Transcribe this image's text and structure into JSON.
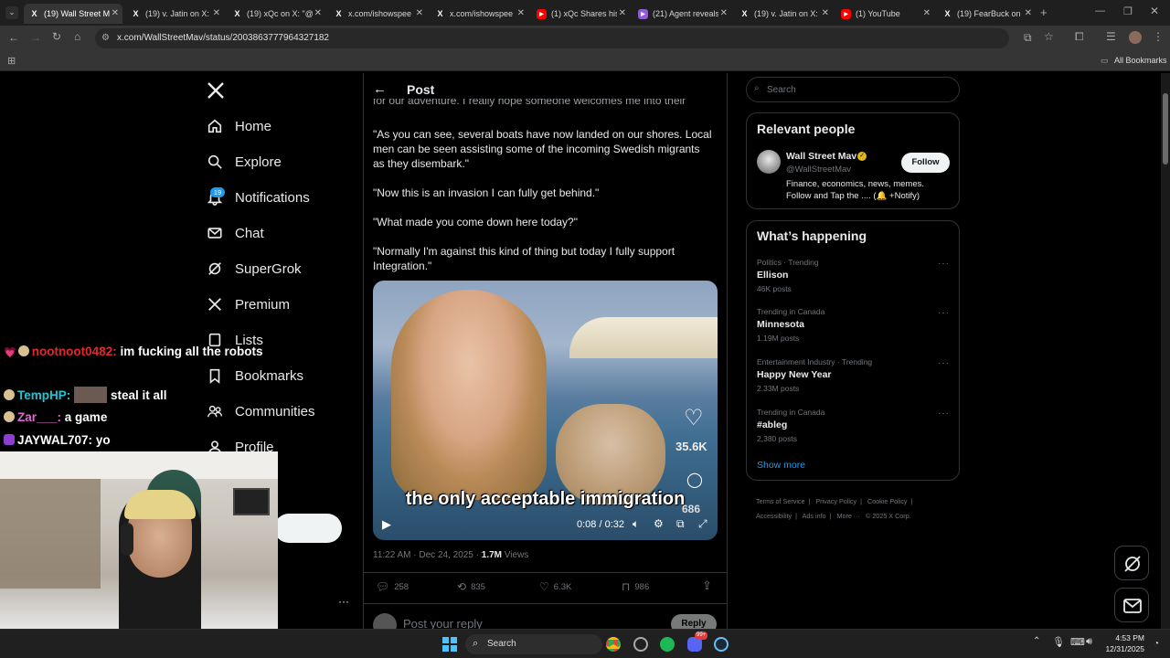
{
  "browser": {
    "tabs": [
      {
        "title": "(19) Wall Street M",
        "active": true
      },
      {
        "title": "(19) v. Jatin on X:"
      },
      {
        "title": "(19) xQc on X: \"@"
      },
      {
        "title": "x.com/ishowspee"
      },
      {
        "title": "x.com/ishowspee"
      },
      {
        "title": "(1) xQc Shares his"
      },
      {
        "title": "(21) Agent reveals"
      },
      {
        "title": "(19) v. Jatin on X:"
      },
      {
        "title": "(1) YouTube"
      },
      {
        "title": "(19) FearBuck on"
      }
    ],
    "url": "x.com/WallStreetMav/status/2003863777964327182",
    "all_bookmarks": "All Bookmarks"
  },
  "nav": {
    "items": [
      {
        "label": "Home"
      },
      {
        "label": "Explore"
      },
      {
        "label": "Notifications",
        "badge": "19"
      },
      {
        "label": "Chat"
      },
      {
        "label": "SuperGrok"
      },
      {
        "label": "Premium"
      },
      {
        "label": "Lists"
      },
      {
        "label": "Bookmarks"
      },
      {
        "label": "Communities"
      },
      {
        "label": "Profile"
      }
    ],
    "more_dots": "···"
  },
  "post": {
    "header": "Post",
    "partial_line": "for our adventure. I really hope someone welcomes me into their home.\"",
    "paragraphs": [
      "\"As you can see, several boats have now landed on our shores. Local men can be seen assisting some of the incoming Swedish migrants as they disembark.\"",
      "\"Now this is an invasion I can fully get behind.\"",
      "\"What made you come down here today?\"",
      "\"Normally I'm against this kind of thing but today I fully support Integration.\""
    ],
    "video": {
      "caption": "the only acceptable immigration",
      "time": "0:08 / 0:32",
      "likes": "35.6K",
      "comments": "686"
    },
    "timestamp": "11:22 AM · Dec 24, 2025 · ",
    "views_count": "1.7M",
    "views_label": " Views",
    "actions": {
      "replies": "258",
      "reposts": "835",
      "likes": "6.3K",
      "bookmarks": "986"
    },
    "reply_placeholder": "Post your reply",
    "reply_button": "Reply"
  },
  "search": {
    "placeholder": "Search"
  },
  "relevant": {
    "title": "Relevant people",
    "name": "Wall Street Mav",
    "handle": "@WallStreetMav",
    "follow": "Follow",
    "bio": "Finance, economics, news, memes. Follow and Tap the .... (🔔 +Notify)"
  },
  "happening": {
    "title": "What’s happening",
    "trends": [
      {
        "cat": "Politics · Trending",
        "name": "Ellison",
        "posts": "46K posts"
      },
      {
        "cat": "Trending in Canada",
        "name": "Minnesota",
        "posts": "1.19M posts"
      },
      {
        "cat": "Entertainment Industry · Trending",
        "name": "Happy New Year",
        "posts": "2.33M posts"
      },
      {
        "cat": "Trending in Canada",
        "name": "#ableg",
        "posts": "2,380 posts"
      }
    ],
    "show_more": "Show more"
  },
  "footer": {
    "links": [
      "Terms of Service",
      "Privacy Policy",
      "Cookie Policy",
      "Accessibility",
      "Ads info",
      "More ···",
      "© 2025 X Corp."
    ]
  },
  "chat": [
    {
      "user": "nootnoot0482:",
      "msg": "im fucking all the robots",
      "color": "#e0282f"
    },
    {
      "user": "TempHP:",
      "msg": "steal it all",
      "color": "#22c4d4"
    },
    {
      "user": "Zar___:",
      "msg": "a game",
      "color": "#e06ad0"
    },
    {
      "user": "JAYWAL707:",
      "msg": "yo",
      "color": "#ffffff"
    }
  ],
  "taskbar": {
    "search": "Search",
    "time": "4:53 PM",
    "date": "12/31/2025",
    "discord_badge": "99+"
  },
  "colors": {
    "accent": "#1d9bf0",
    "bg": "#000000",
    "border": "#2f3336",
    "muted": "#71767b"
  }
}
